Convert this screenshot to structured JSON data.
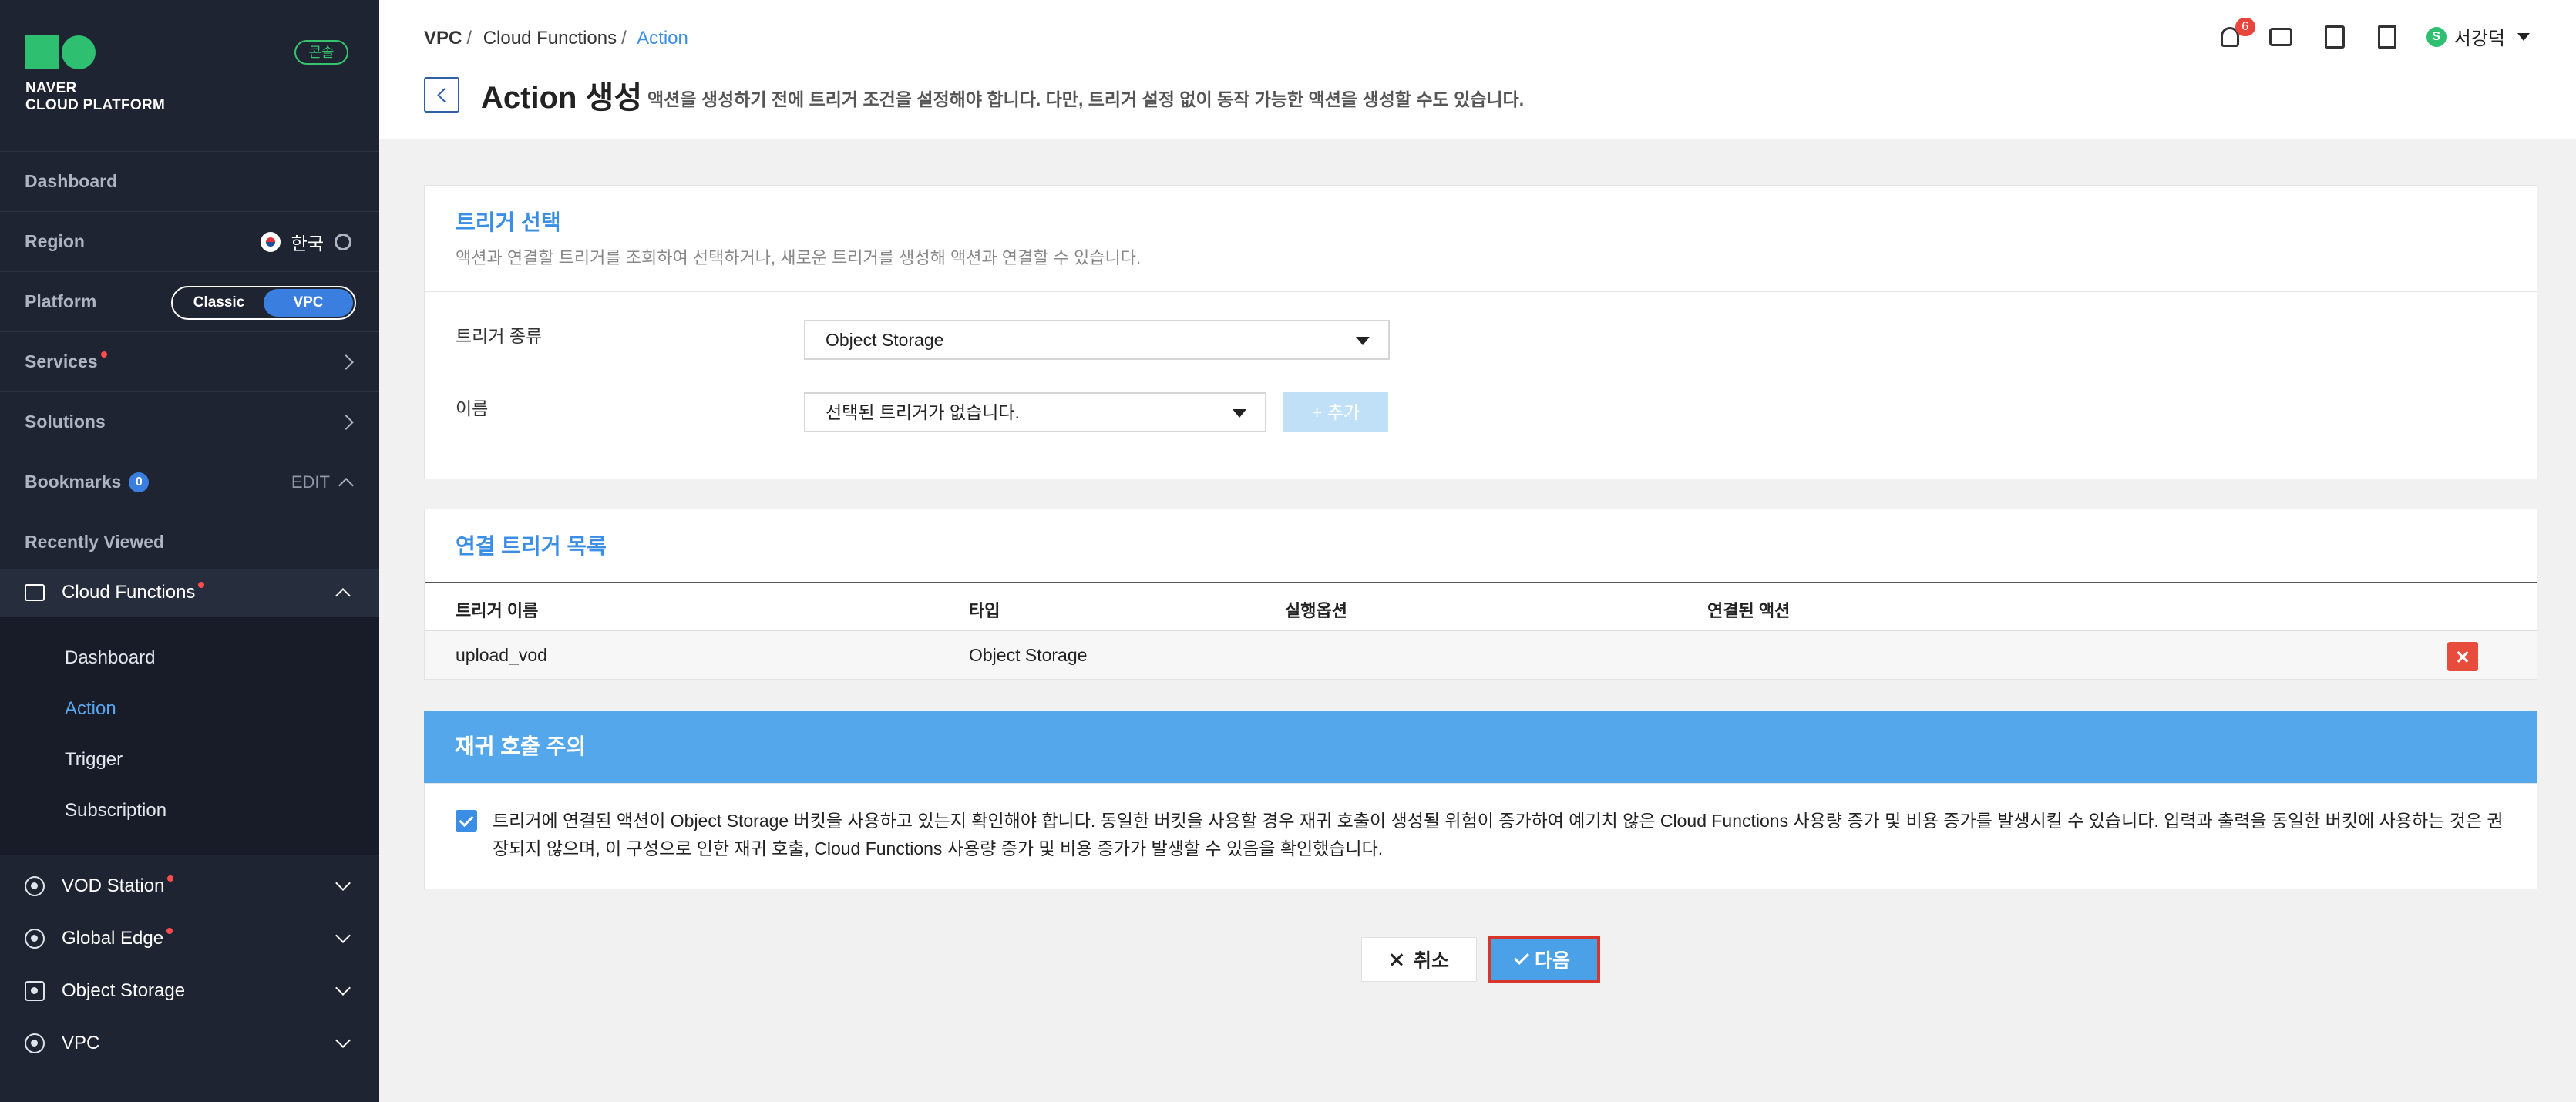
{
  "brand": {
    "line1": "NAVER",
    "line2": "CLOUD PLATFORM",
    "console_badge": "콘솔"
  },
  "sidebar": {
    "dashboard": "Dashboard",
    "region_label": "Region",
    "region_value": "한국",
    "platform_label": "Platform",
    "platform_options": [
      "Classic",
      "VPC"
    ],
    "platform_selected": "VPC",
    "services": "Services",
    "solutions": "Solutions",
    "bookmarks": "Bookmarks",
    "bookmarks_count": "0",
    "bookmarks_edit": "EDIT",
    "recently_viewed": "Recently Viewed",
    "current_service": "Cloud Functions",
    "sub_items": [
      "Dashboard",
      "Action",
      "Trigger",
      "Subscription"
    ],
    "active_sub_item": "Action",
    "other_services": [
      "VOD Station",
      "Global Edge",
      "Object Storage",
      "VPC"
    ]
  },
  "header": {
    "breadcrumb": [
      "VPC",
      "Cloud Functions",
      "Action"
    ],
    "title": "Action 생성",
    "description": "액션을 생성하기 전에 트리거 조건을 설정해야 합니다. 다만, 트리거 설정 없이 동작 가능한 액션을 생성할 수도 있습니다.",
    "notification_count": "6",
    "user_initial": "S",
    "user_name": "서강덕"
  },
  "trigger_select": {
    "title": "트리거 선택",
    "subtitle": "액션과 연결할 트리거를 조회하여 선택하거나, 새로운 트리거를 생성해 액션과 연결할 수 있습니다.",
    "type_label": "트리거 종류",
    "type_value": "Object Storage",
    "name_label": "이름",
    "name_value": "선택된 트리거가 없습니다.",
    "add_button": "+ 추가"
  },
  "linked_triggers": {
    "title": "연결 트리거 목록",
    "columns": [
      "트리거 이름",
      "타입",
      "실행옵션",
      "연결된 액션"
    ],
    "rows": [
      {
        "name": "upload_vod",
        "type": "Object Storage",
        "option": "",
        "action": ""
      }
    ]
  },
  "recursion_warning": {
    "title": "재귀 호출 주의",
    "checked": true,
    "text": "트리거에 연결된 액션이 Object Storage 버킷을 사용하고 있는지 확인해야 합니다. 동일한 버킷을 사용할 경우 재귀 호출이 생성될 위험이 증가하여 예기치 않은 Cloud Functions 사용량 증가 및 비용 증가를 발생시킬 수 있습니다. 입력과 출력을 동일한 버킷에 사용하는 것은 권장되지 않으며, 이 구성으로 인한 재귀 호출, Cloud Functions 사용량 증가 및 비용 증가가 발생할 수 있음을 확인했습니다."
  },
  "footer": {
    "cancel": "취소",
    "next": "다음"
  },
  "colors": {
    "accent": "#3a8ee6",
    "sidebar_bg": "#1e2432",
    "danger": "#e84c3d",
    "warning_bar": "#53a7ea"
  }
}
